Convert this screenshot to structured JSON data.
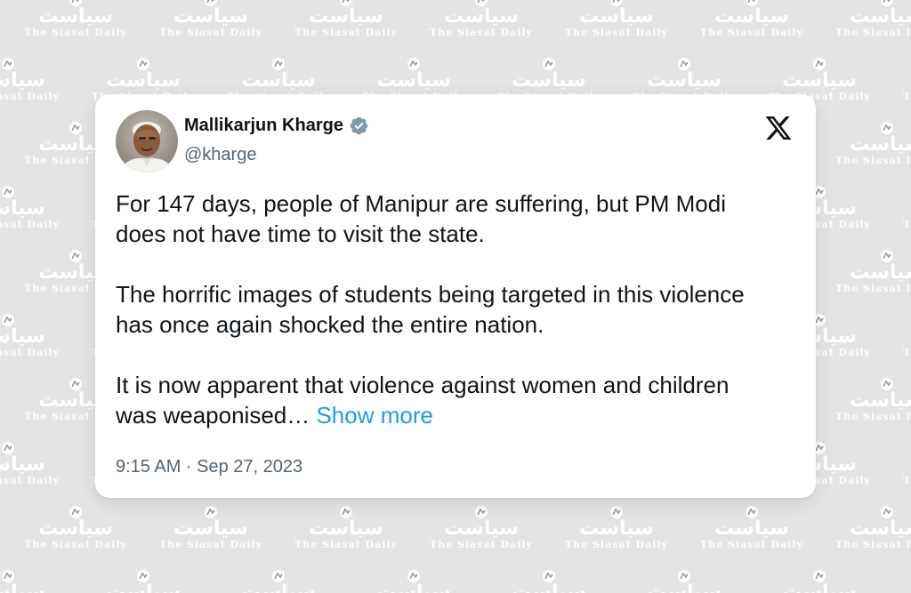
{
  "background": {
    "watermark_urdu": "سیاست",
    "watermark_name": "The Siasat Daily",
    "color": "#e4e4e4"
  },
  "tweet": {
    "author_name": "Mallikarjun Kharge",
    "handle": "@kharge",
    "paragraphs": [
      "For 147 days, people of Manipur are suffering, but PM Modi does not have time to visit the state.",
      "The horrific images of students being targeted in this violence has once again shocked the entire nation."
    ],
    "last_paragraph": "It is now apparent that violence against women and children was weaponised…",
    "show_more": "Show more",
    "timestamp": "9:15 AM · Sep 27, 2023",
    "verified": true,
    "colors": {
      "accent": "#1d9bf0",
      "text": "#0f1419",
      "muted": "#536471",
      "verified_badge": "#829aab"
    },
    "icons": {
      "verified": "verified-badge-icon",
      "platform": "x-logo-icon"
    }
  }
}
